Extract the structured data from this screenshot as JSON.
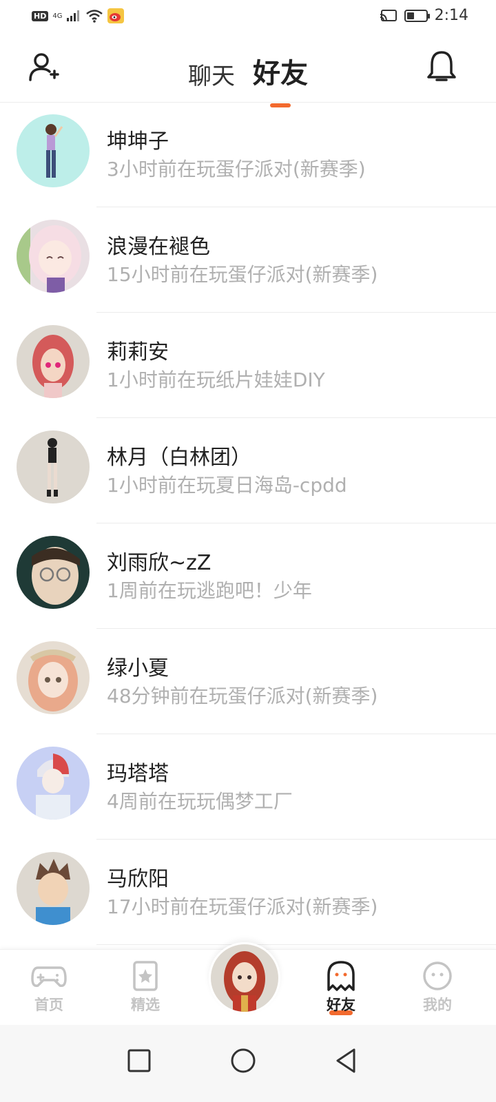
{
  "status_bar": {
    "hd": "HD",
    "network": "4G",
    "time": "2:14",
    "icons": [
      "signal-icon",
      "wifi-icon",
      "weibo-icon",
      "cast-icon",
      "battery-icon"
    ]
  },
  "header": {
    "tabs": [
      {
        "label": "聊天",
        "active": false
      },
      {
        "label": "好友",
        "active": true
      }
    ],
    "left_icon": "add-friend-icon",
    "right_icon": "bell-icon",
    "accent_color": "#f26a2e"
  },
  "friends": [
    {
      "name": "坤坤子",
      "status": "3小时前在玩蛋仔派对(新赛季)"
    },
    {
      "name": "浪漫在褪色",
      "status": "15小时前在玩蛋仔派对(新赛季)"
    },
    {
      "name": "莉莉安",
      "status": "1小时前在玩纸片娃娃DIY"
    },
    {
      "name": "林月（白林团）",
      "status": "1小时前在玩夏日海岛-cpdd"
    },
    {
      "name": "刘雨欣~zZ",
      "status": "1周前在玩逃跑吧！少年"
    },
    {
      "name": "绿小夏",
      "status": "48分钟前在玩蛋仔派对(新赛季)"
    },
    {
      "name": "玛塔塔",
      "status": "4周前在玩玩偶梦工厂"
    },
    {
      "name": "马欣阳",
      "status": "17小时前在玩蛋仔派对(新赛季)"
    }
  ],
  "bottom_nav": {
    "items": [
      {
        "label": "首页",
        "icon": "gamepad-icon",
        "active": false
      },
      {
        "label": "精选",
        "icon": "star-badge-icon",
        "active": false
      },
      {
        "label": "好友",
        "icon": "ghost-icon",
        "active": true
      },
      {
        "label": "我的",
        "icon": "smiley-icon",
        "active": false
      }
    ]
  },
  "system_nav": {
    "icons": [
      "recent-apps-icon",
      "home-icon",
      "back-icon"
    ]
  }
}
